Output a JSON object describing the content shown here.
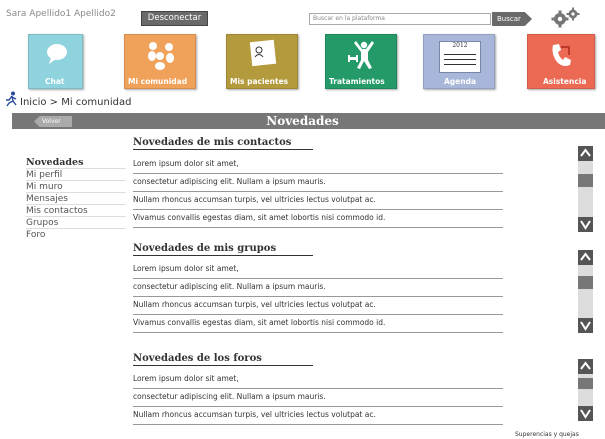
{
  "header": {
    "user_name": "Sara Apellido1 Apellido2",
    "logout_label": "Desconectar",
    "search_placeholder": "Buscar en la plataforma",
    "search_button": "Buscar",
    "settings_icon": "gears-icon"
  },
  "tiles": [
    {
      "label": "Chat",
      "color": "#8fd3de",
      "icon": "speech-bubble-icon"
    },
    {
      "label": "Mi comunidad",
      "color": "#f0a15a",
      "icon": "community-icon"
    },
    {
      "label": "Mis pacientes",
      "color": "#b39a3c",
      "icon": "patient-card-icon"
    },
    {
      "label": "Tratamientos",
      "color": "#239a67",
      "icon": "exercise-icon"
    },
    {
      "label": "Agenda",
      "color": "#a8b6d9",
      "icon": "calendar-icon",
      "year": "2012"
    },
    {
      "label": "Asistencia",
      "color": "#ec6a53",
      "icon": "phone-icon"
    }
  ],
  "breadcrumb": "Inicio > Mi comunidad",
  "page_title": "Novedades",
  "back_label": "Volver",
  "sidenav": [
    "Novedades",
    "Mi perfil",
    "Mi muro",
    "Mensajes",
    "Mis contactos",
    "Grupos",
    "Foro"
  ],
  "sections": [
    {
      "title": "Novedades de mis contactos",
      "rows": [
        "Lorem ipsum dolor sit amet,",
        "consectetur adipiscing elit. Nullam a ipsum mauris.",
        "Nullam rhoncus accumsan turpis, vel ultricies lectus volutpat ac.",
        "Vivamus convallis egestas diam, sit amet lobortis nisi commodo id."
      ]
    },
    {
      "title": "Novedades de mis grupos",
      "rows": [
        "Lorem ipsum dolor sit amet,",
        "consectetur adipiscing elit. Nullam a ipsum mauris.",
        "Nullam rhoncus accumsan turpis, vel ultricies lectus volutpat ac.",
        "Vivamus convallis egestas diam, sit amet lobortis nisi commodo id."
      ]
    },
    {
      "title": "Novedades de los foros",
      "rows": [
        "Lorem ipsum dolor sit amet,",
        "consectetur adipiscing elit. Nullam a ipsum mauris.",
        "Nullam rhoncus accumsan turpis, vel ultricies lectus volutpat ac."
      ]
    }
  ],
  "scroll_up": "^",
  "scroll_down": "V",
  "footer": "Superencias y quejas"
}
